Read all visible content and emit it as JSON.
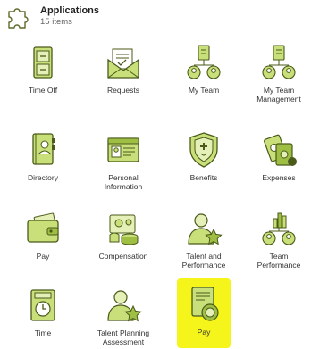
{
  "header": {
    "title": "Applications",
    "count": "15 items",
    "icon": "puzzle-icon"
  },
  "apps": [
    {
      "label": "Time Off",
      "icon": "cabinet-icon"
    },
    {
      "label": "Requests",
      "icon": "envelope-icon"
    },
    {
      "label": "My Team",
      "icon": "team-icon"
    },
    {
      "label": "My Team\nManagement",
      "icon": "team-management-icon"
    },
    {
      "label": "Directory",
      "icon": "directory-icon"
    },
    {
      "label": "Personal\nInformation",
      "icon": "id-card-icon"
    },
    {
      "label": "Benefits",
      "icon": "shield-icon"
    },
    {
      "label": "Expenses",
      "icon": "money-icon"
    },
    {
      "label": "Pay",
      "icon": "wallet-icon"
    },
    {
      "label": "Compensation",
      "icon": "compensation-icon"
    },
    {
      "label": "Talent and\nPerformance",
      "icon": "talent-star-icon"
    },
    {
      "label": "Team\nPerformance",
      "icon": "team-performance-icon"
    },
    {
      "label": "Time",
      "icon": "clock-icon"
    },
    {
      "label": "Talent Planning\nAssessment",
      "icon": "talent-planning-icon"
    },
    {
      "label": "Pay",
      "icon": "payslip-icon",
      "highlighted": true
    }
  ],
  "colors": {
    "icon_fill": "#c9e07a",
    "icon_stroke": "#4a5a1a",
    "highlight": "#f5f51c"
  }
}
